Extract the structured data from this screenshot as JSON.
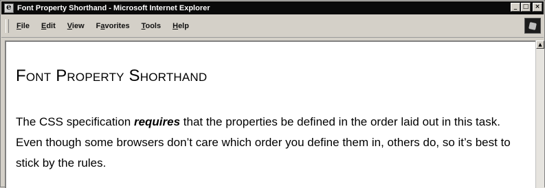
{
  "window": {
    "title": "Font Property Shorthand - Microsoft Internet Explorer",
    "minimize_glyph": "_",
    "maximize_glyph": "□",
    "close_glyph": "×"
  },
  "menu": {
    "items": [
      {
        "accel": "F",
        "rest": "ile"
      },
      {
        "accel": "E",
        "rest": "dit"
      },
      {
        "accel": "V",
        "rest": "iew"
      },
      {
        "pre": "F",
        "accel": "a",
        "rest": "vorites"
      },
      {
        "accel": "T",
        "rest": "ools"
      },
      {
        "accel": "H",
        "rest": "elp"
      }
    ]
  },
  "page": {
    "heading": "Font Property Shorthand",
    "paragraph": {
      "before": "The CSS specification ",
      "emphasis": "requires",
      "after": " that the properties be defined in the order laid out in this task. Even though some browsers don’t care which order you define them in, others do, so it’s best to stick by the rules."
    }
  },
  "icons": {
    "app": "ie-icon",
    "throbber": "windows-throbber-icon",
    "scroll_up": "scroll-up-arrow-icon",
    "scroll_up_glyph": "▲"
  },
  "colors": {
    "titlebar_bg": "#0a0a0a",
    "chrome_bg": "#d4d0c8",
    "content_bg": "#ffffff"
  }
}
